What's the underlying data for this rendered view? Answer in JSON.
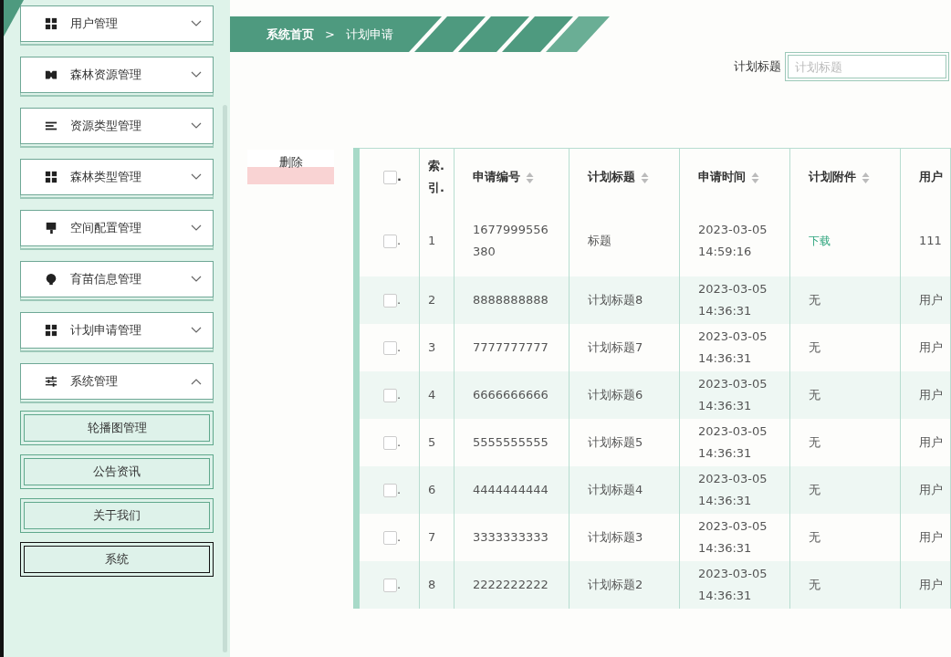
{
  "sidebar": {
    "menu": [
      {
        "label": "用户管理",
        "expanded": false
      },
      {
        "label": "森林资源管理",
        "expanded": false
      },
      {
        "label": "资源类型管理",
        "expanded": false
      },
      {
        "label": "森林类型管理",
        "expanded": false
      },
      {
        "label": "空间配置管理",
        "expanded": false
      },
      {
        "label": "育苗信息管理",
        "expanded": false
      },
      {
        "label": "计划申请管理",
        "expanded": false
      },
      {
        "label": "系统管理",
        "expanded": true,
        "children": [
          {
            "label": "轮播图管理",
            "selected": false
          },
          {
            "label": "公告资讯",
            "selected": false
          },
          {
            "label": "关于我们",
            "selected": false
          },
          {
            "label": "系统",
            "selected": true
          }
        ]
      }
    ]
  },
  "breadcrumb": {
    "home": "系统首页",
    "separator": ">",
    "current": "计划申请"
  },
  "search": {
    "label": "计划标题",
    "placeholder": "计划标题"
  },
  "delete_button": "删除",
  "table": {
    "check_suffix": ".",
    "header_checked": false,
    "columns": [
      {
        "label": "索.引.",
        "sortable": false
      },
      {
        "label": "申请编号",
        "sortable": true
      },
      {
        "label": "计划标题",
        "sortable": true
      },
      {
        "label": "申请时间",
        "sortable": true
      },
      {
        "label": "计划附件",
        "sortable": true
      },
      {
        "label": "用户",
        "sortable": false
      }
    ],
    "rows": [
      {
        "checked": false,
        "cells": [
          "1",
          "1677999556380",
          "标题",
          "2023-03-05 14:59:16",
          "下载",
          "111"
        ],
        "attachment_link": true
      },
      {
        "checked": false,
        "cells": [
          "2",
          "8888888888",
          "计划标题8",
          "2023-03-05 14:36:31",
          "无",
          "用户"
        ],
        "attachment_link": false
      },
      {
        "checked": false,
        "cells": [
          "3",
          "7777777777",
          "计划标题7",
          "2023-03-05 14:36:31",
          "无",
          "用户"
        ],
        "attachment_link": false
      },
      {
        "checked": false,
        "cells": [
          "4",
          "6666666666",
          "计划标题6",
          "2023-03-05 14:36:31",
          "无",
          "用户"
        ],
        "attachment_link": false
      },
      {
        "checked": false,
        "cells": [
          "5",
          "5555555555",
          "计划标题5",
          "2023-03-05 14:36:31",
          "无",
          "用户"
        ],
        "attachment_link": false
      },
      {
        "checked": false,
        "cells": [
          "6",
          "4444444444",
          "计划标题4",
          "2023-03-05 14:36:31",
          "无",
          "用户"
        ],
        "attachment_link": false
      },
      {
        "checked": false,
        "cells": [
          "7",
          "3333333333",
          "计划标题3",
          "2023-03-05 14:36:31",
          "无",
          "用户"
        ],
        "attachment_link": false
      },
      {
        "checked": false,
        "cells": [
          "8",
          "2222222222",
          "计划标题2",
          "2023-03-05 14:36:31",
          "无",
          "用户"
        ],
        "attachment_link": false
      }
    ]
  }
}
